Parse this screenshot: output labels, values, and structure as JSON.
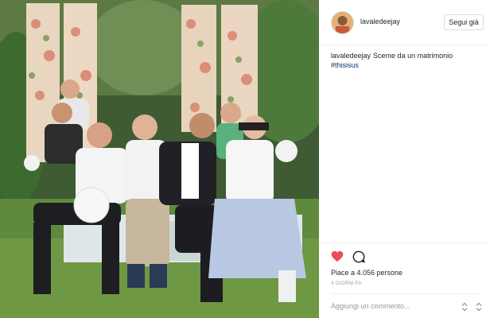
{
  "post": {
    "username": "lavaledeejay",
    "follow_label": "Segui già",
    "caption_username": "lavaledeejay",
    "caption_text": "Sceme da un matrimonio",
    "hashtag": "#thisisus",
    "likes_text": "Piace a 4.056 persone",
    "timestamp": "4 GIORNI FA",
    "comment_placeholder": "Aggiungi un commento..."
  },
  "icons": {
    "like": "heart-icon",
    "comment": "comment-icon",
    "more": "more-options-icon",
    "scroll": "scroll-handle-icon"
  },
  "colors": {
    "like_red": "#ed4956",
    "hashtag_blue": "#003569",
    "muted_gray": "#999999",
    "border": "#dbdbdb"
  }
}
